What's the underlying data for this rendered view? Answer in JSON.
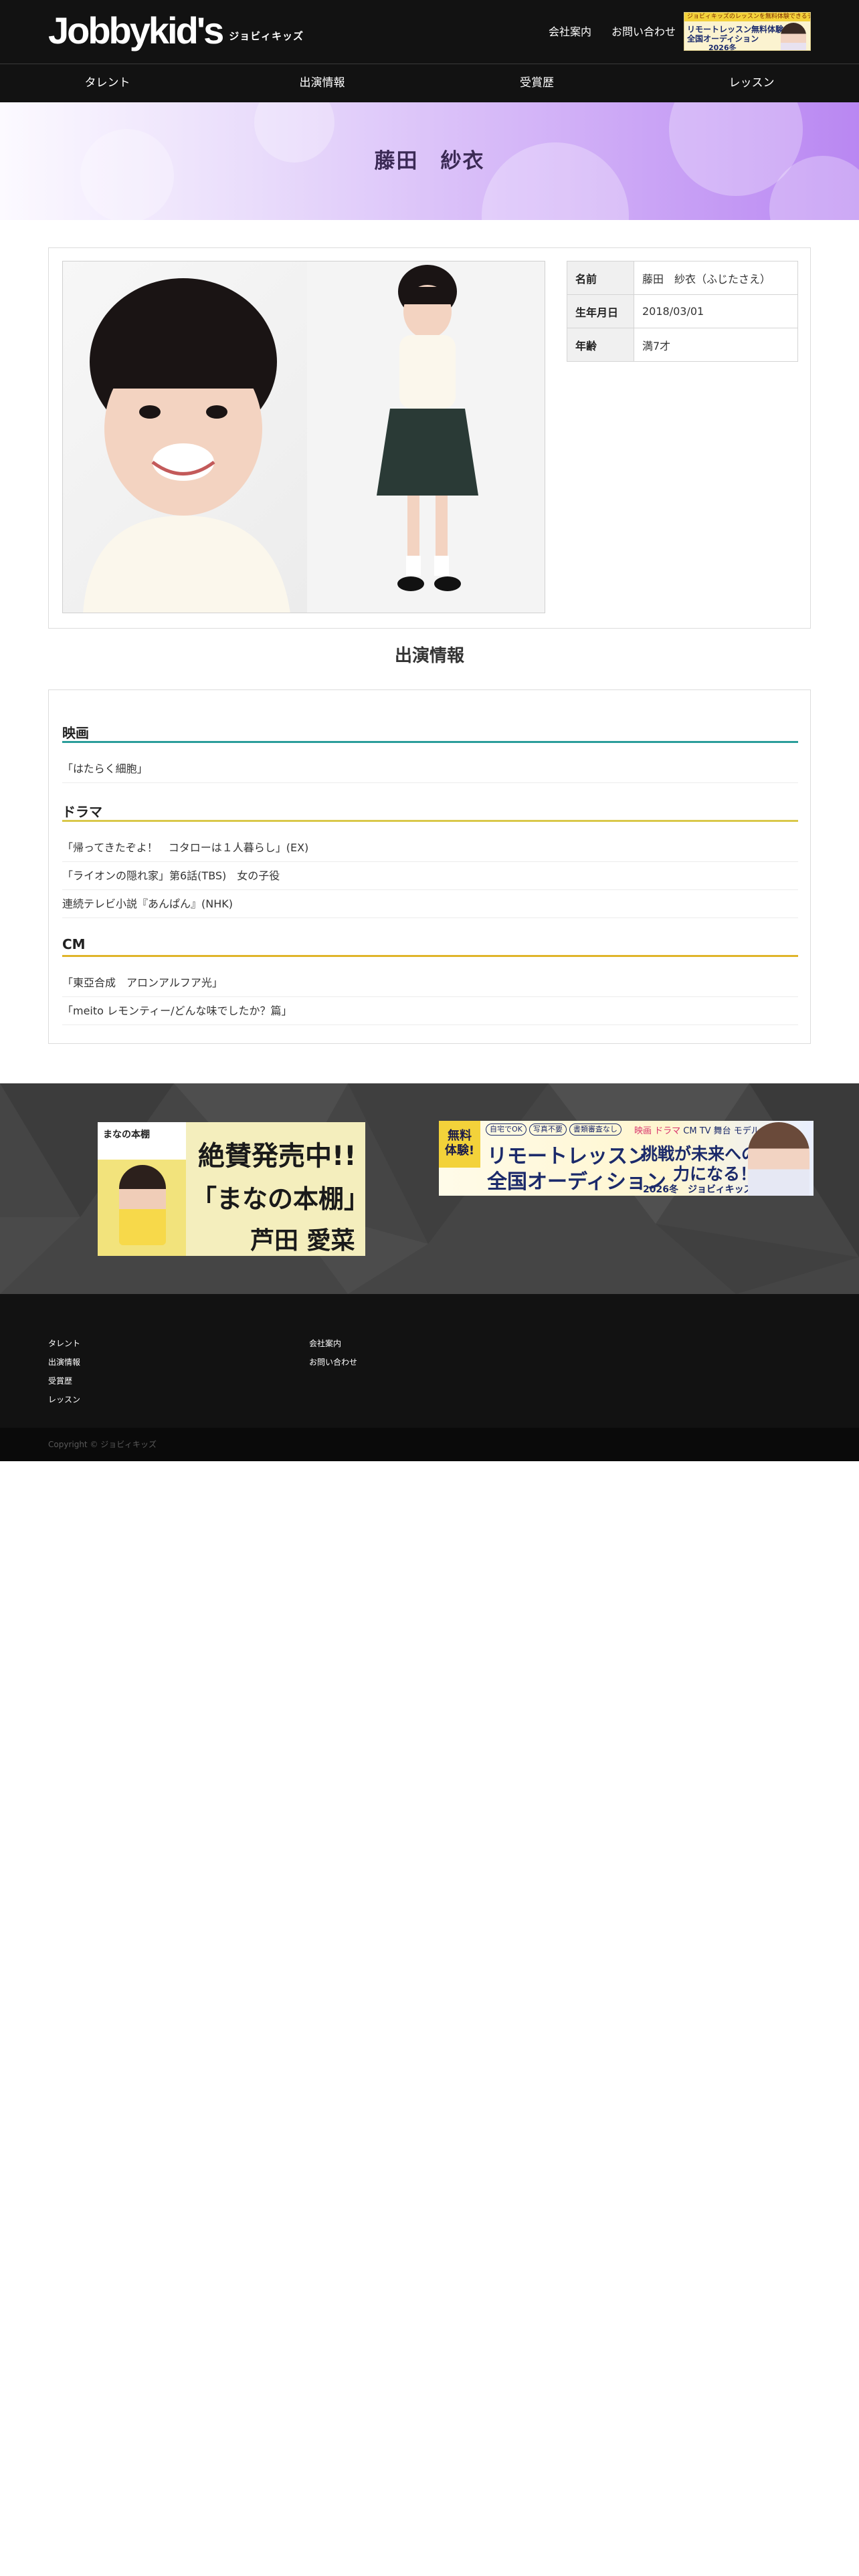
{
  "brand": {
    "logo_text": "Jobbykid's",
    "logo_sub": "ジョビィキッズ"
  },
  "header": {
    "links": [
      {
        "label": "会社案内"
      },
      {
        "label": "お問い合わせ"
      }
    ],
    "banner": {
      "top_text": "ジョビィキッズのレッスンを無料体験できるチャンス！",
      "line1": "リモートレッスン無料体験",
      "line2": "全国オーディション",
      "line3": "2026冬"
    }
  },
  "nav": [
    {
      "label": "タレント"
    },
    {
      "label": "出演情報"
    },
    {
      "label": "受賞歴"
    },
    {
      "label": "レッスン"
    }
  ],
  "hero": {
    "title": "藤田　紗衣"
  },
  "profile": {
    "rows": [
      {
        "key": "名前",
        "value": "藤田　紗衣（ふじたさえ）"
      },
      {
        "key": "生年月日",
        "value": "2018/03/01"
      },
      {
        "key": "年齢",
        "value": "満7才"
      }
    ]
  },
  "works": {
    "heading": "出演情報",
    "categories": [
      {
        "name": "映画",
        "color": "#2a9d9a",
        "items": [
          "「はたらく細胞」"
        ]
      },
      {
        "name": "ドラマ",
        "color": "#d9c84a",
        "items": [
          "「帰ってきたぞよ！　コタローは１人暮らし」(EX)",
          "「ライオンの隠れ家」第6話(TBS)　女の子役",
          "連続テレビ小説『あんぱん』(NHK)"
        ]
      },
      {
        "name": "CM",
        "color": "#e0b52a",
        "items": [
          "「東亞合成　アロンアルフア光」",
          "「meito レモンティー/どんな味でしたか？篇」"
        ]
      }
    ]
  },
  "promo": {
    "book": {
      "cover_title": "まなの本棚",
      "line1": "絶賛発売中!!",
      "line2": "「まなの本棚」",
      "line3": "芦田 愛菜"
    },
    "audition": {
      "badge": "無料\n体験!",
      "tags": [
        "自宅でOK",
        "写真不要",
        "書類審査なし"
      ],
      "genres_pink": "映画 ドラマ",
      "genres_rest": " CM TV 舞台 モデル 声優",
      "line1": "リモートレッスン",
      "line2": "全国オーディション",
      "line3": "挑戦が未来への",
      "line4": "力になる！",
      "line5": "2026冬　ジョビィキッズ"
    }
  },
  "footer": {
    "col1": [
      {
        "label": "タレント"
      },
      {
        "label": "出演情報"
      },
      {
        "label": "受賞歴"
      },
      {
        "label": "レッスン"
      }
    ],
    "col2": [
      {
        "label": "会社案内"
      },
      {
        "label": "お問い合わせ"
      }
    ],
    "copyright": "Copyright © ジョビィキッズ"
  },
  "colors": {
    "header_bg": "#121212",
    "hero_accent": "#b987f2",
    "promo_bg": "#454545"
  }
}
